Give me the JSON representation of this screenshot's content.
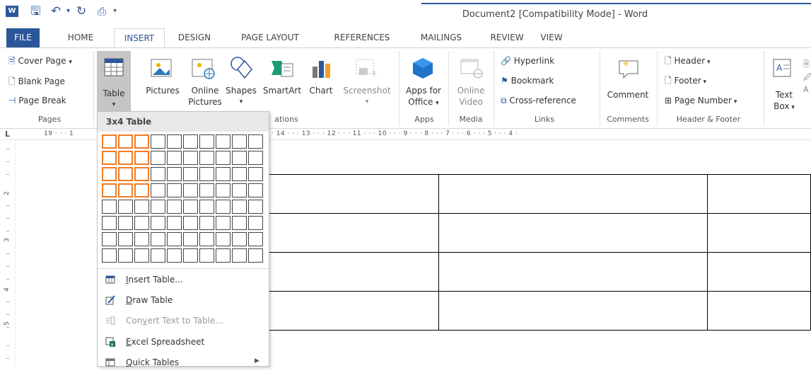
{
  "window": {
    "title": "Document2 [Compatibility Mode] - Word"
  },
  "tabs": [
    "FILE",
    "HOME",
    "INSERT",
    "DESIGN",
    "PAGE LAYOUT",
    "REFERENCES",
    "MAILINGS",
    "REVIEW",
    "VIEW"
  ],
  "ribbon": {
    "pages": {
      "cover_page": "Cover Page",
      "blank_page": "Blank Page",
      "page_break": "Page Break",
      "label": "Pages"
    },
    "table": {
      "label1": "Table",
      "label2": "▾"
    },
    "illustrations": {
      "pictures": "Pictures",
      "online1": "Online",
      "online2": "Pictures",
      "shapes": "Shapes",
      "smartart": "SmartArt",
      "chart": "Chart",
      "screenshot": "Screenshot",
      "label": "ations"
    },
    "apps": {
      "line1": "Apps for",
      "line2": "Office",
      "label": "Apps"
    },
    "media": {
      "line1": "Online",
      "line2": "Video",
      "label": "Media"
    },
    "links": {
      "hyperlink": "Hyperlink",
      "bookmark": "Bookmark",
      "crossref": "Cross-reference",
      "label": "Links"
    },
    "comments": {
      "comment": "Comment",
      "label": "Comments"
    },
    "header_footer": {
      "header": "Header",
      "footer": "Footer",
      "page_number": "Page Number",
      "label": "Header & Footer"
    },
    "text": {
      "line1": "Text",
      "line2": "Box"
    }
  },
  "ruler": {
    "left": "19 · · · 1",
    "right": "· 14 · · · 13 · · · 12 · · · 11 · · · 10 · · · 9 · · · 8 · · · 7 · · · 6 · · · 5 · · · 4 ·",
    "vertical": [
      "2",
      "3",
      "4",
      "5"
    ],
    "corner": "L"
  },
  "dropdown": {
    "header": "3x4 Table",
    "grid": {
      "cols": 10,
      "rows": 8,
      "sel_cols": 3,
      "sel_rows": 4
    },
    "items": {
      "insert_table_a": "I",
      "insert_table_b": "nsert Table...",
      "draw_table_a": "D",
      "draw_table_b": "raw Table",
      "convert_a": "Con",
      "convert_u": "v",
      "convert_b": "ert Text to Table...",
      "excel_a": "E",
      "excel_b": "xcel Spreadsheet",
      "quick_a": "Q",
      "quick_b": "uick Tables"
    }
  },
  "colors": {
    "accent": "#2b579a",
    "selection": "#f07b25"
  }
}
